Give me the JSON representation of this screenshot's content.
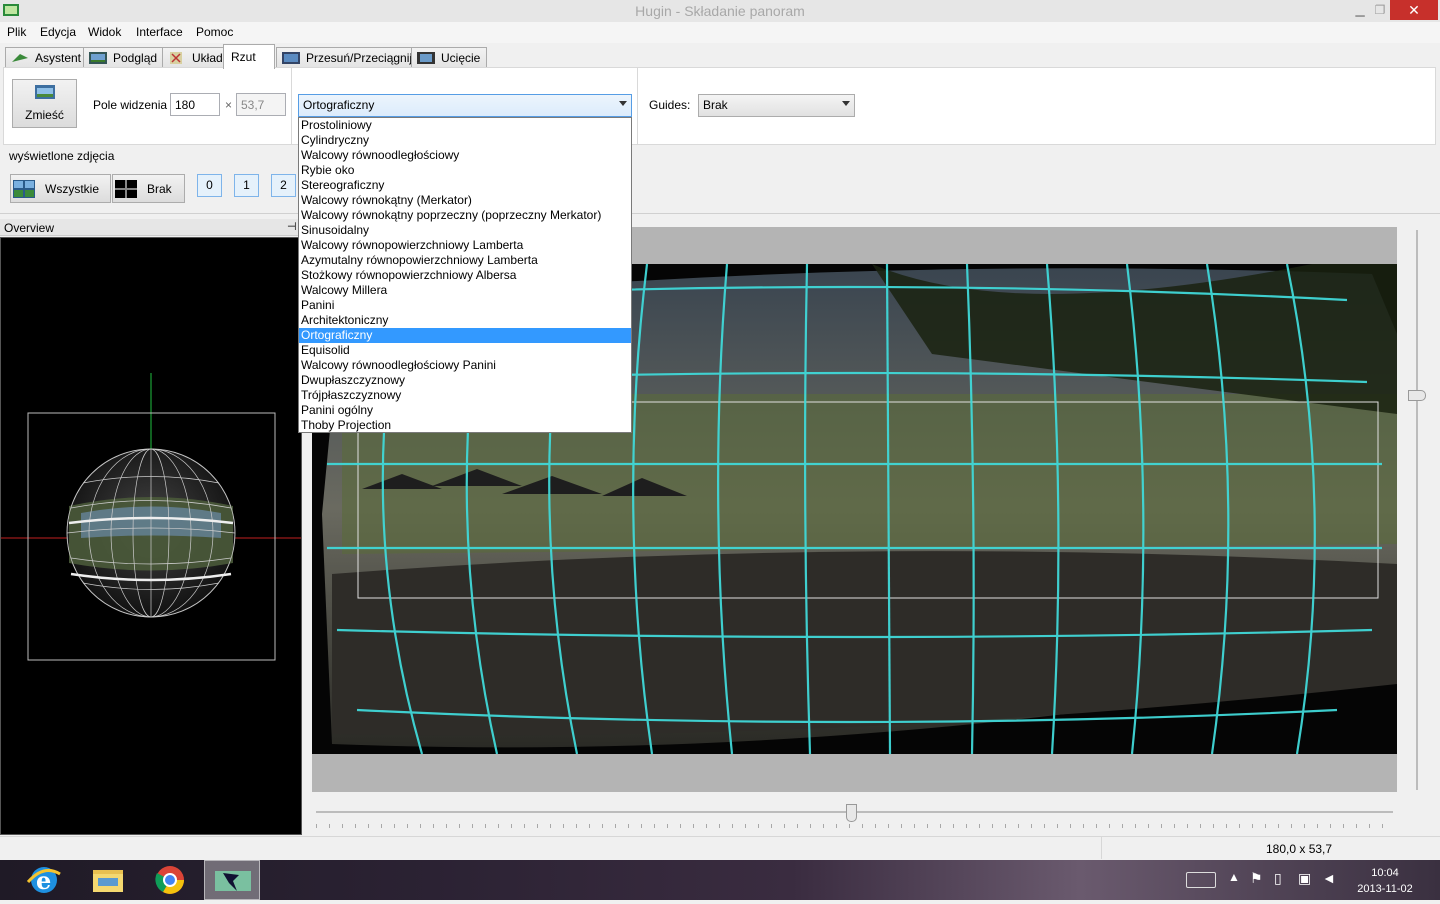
{
  "window": {
    "title": "Hugin - Składanie panoram",
    "minimize_icon": "minimize-icon",
    "maximize_icon": "maximize-icon",
    "close_label": "✕"
  },
  "menu": [
    "Plik",
    "Edycja",
    "Widok",
    "Interface",
    "Pomoc"
  ],
  "tabs": [
    {
      "label": "Asystent",
      "icon": "assistant-icon"
    },
    {
      "label": "Podgląd",
      "icon": "preview-icon"
    },
    {
      "label": "Układ",
      "icon": "layout-icon"
    },
    {
      "label": "Rzut",
      "icon": ""
    },
    {
      "label": "Przesuń/Przeciągnij",
      "icon": "move-icon"
    },
    {
      "label": "Ucięcie",
      "icon": "crop-icon"
    }
  ],
  "toolbar": {
    "fit_button": "Zmieść",
    "fov_label": "Pole widzenia",
    "fov_h": "180",
    "fov_sep": "×",
    "fov_v": "53,7",
    "projection_selected": "Ortograficzny",
    "guides_label": "Guides:",
    "guides_value": "Brak"
  },
  "projection_options": [
    "Prostoliniowy",
    "Cylindryczny",
    "Walcowy równoodległościowy",
    "Rybie oko",
    "Stereograficzny",
    "Walcowy równokątny (Merkator)",
    "Walcowy równokątny poprzeczny (poprzeczny Merkator)",
    "Sinusoidalny",
    "Walcowy równopowierzchniowy Lamberta",
    "Azymutalny równopowierzchniowy Lamberta",
    "Stożkowy równopowierzchniowy Albersa",
    "Walcowy Millera",
    "Panini",
    "Architektoniczny",
    "Ortograficzny",
    "Equisolid",
    "Walcowy równoodległościowy Panini",
    "Dwupłaszczyznowy",
    "Trójpłaszczyznowy",
    "Panini ogólny",
    "Thoby Projection"
  ],
  "images_bar": {
    "label": "wyświetlone zdjęcia",
    "all_button": "Wszystkie",
    "none_button": "Brak",
    "image_buttons": [
      "0",
      "1",
      "2"
    ]
  },
  "overview": {
    "title": "Overview"
  },
  "status": {
    "fov": "180,0 x 53,7"
  },
  "taskbar": {
    "apps": [
      "internet-explorer-icon",
      "file-explorer-icon",
      "chrome-icon",
      "hugin-icon"
    ],
    "time": "10:04",
    "date": "2013-11-02"
  }
}
